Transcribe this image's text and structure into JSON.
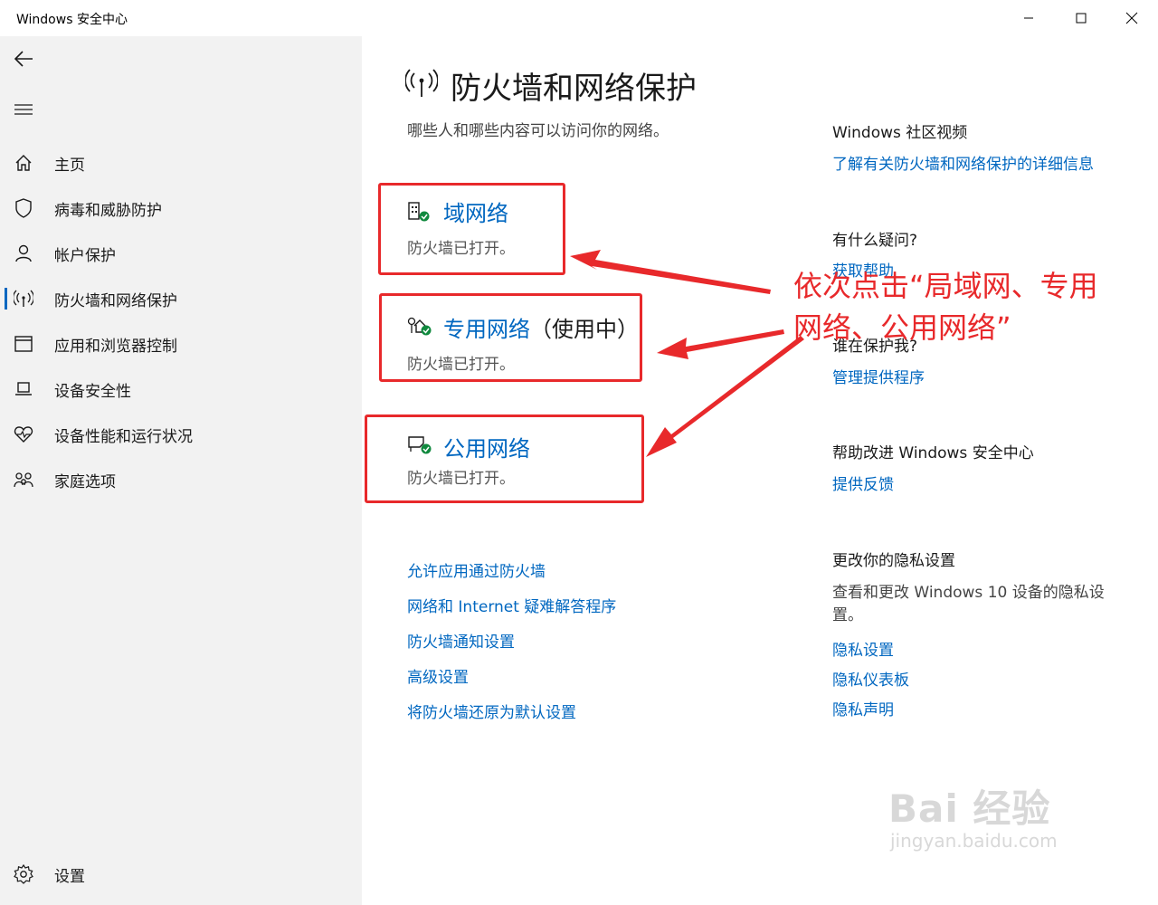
{
  "window": {
    "title": "Windows 安全中心"
  },
  "sidebar": {
    "items": [
      {
        "label": "主页",
        "icon": "home-icon"
      },
      {
        "label": "病毒和威胁防护",
        "icon": "shield-icon"
      },
      {
        "label": "帐户保护",
        "icon": "person-icon"
      },
      {
        "label": "防火墙和网络保护",
        "icon": "wifi-antenna-icon",
        "active": true
      },
      {
        "label": "应用和浏览器控制",
        "icon": "browser-window-icon"
      },
      {
        "label": "设备安全性",
        "icon": "laptop-icon"
      },
      {
        "label": "设备性能和运行状况",
        "icon": "heart-pulse-icon"
      },
      {
        "label": "家庭选项",
        "icon": "family-icon"
      }
    ],
    "settings_label": "设置"
  },
  "main": {
    "title": "防火墙和网络保护",
    "subtitle": "哪些人和哪些内容可以访问你的网络。",
    "networks": [
      {
        "name": "域网络",
        "suffix": "",
        "status": "防火墙已打开。",
        "icon": "domain-building-icon"
      },
      {
        "name": "专用网络",
        "suffix": "（使用中）",
        "status": "防火墙已打开。",
        "icon": "private-home-icon"
      },
      {
        "name": "公用网络",
        "suffix": "",
        "status": "防火墙已打开。",
        "icon": "public-bench-icon"
      }
    ],
    "links": [
      "允许应用通过防火墙",
      "网络和 Internet 疑难解答程序",
      "防火墙通知设置",
      "高级设置",
      "将防火墙还原为默认设置"
    ]
  },
  "side_panel": {
    "community": {
      "heading": "Windows 社区视频",
      "link": "了解有关防火墙和网络保护的详细信息"
    },
    "question": {
      "heading": "有什么疑问?",
      "link": "获取帮助"
    },
    "protection": {
      "heading": "谁在保护我?",
      "link": "管理提供程序"
    },
    "improve": {
      "heading": "帮助改进 Windows 安全中心",
      "link": "提供反馈"
    },
    "privacy": {
      "heading": "更改你的隐私设置",
      "text": "查看和更改 Windows 10 设备的隐私设置。",
      "links": [
        "隐私设置",
        "隐私仪表板",
        "隐私声明"
      ]
    }
  },
  "annotation": {
    "line1": "依次点击“局域网、专用",
    "line2": "网络、公用网络”"
  },
  "watermark": {
    "main": "Bai 经验",
    "sub": "jingyan.baidu.com"
  },
  "colors": {
    "accent": "#0067c0",
    "annotation_red": "#e8292b",
    "success_green": "#10893e",
    "sidebar_bg": "#f2f2f2"
  }
}
